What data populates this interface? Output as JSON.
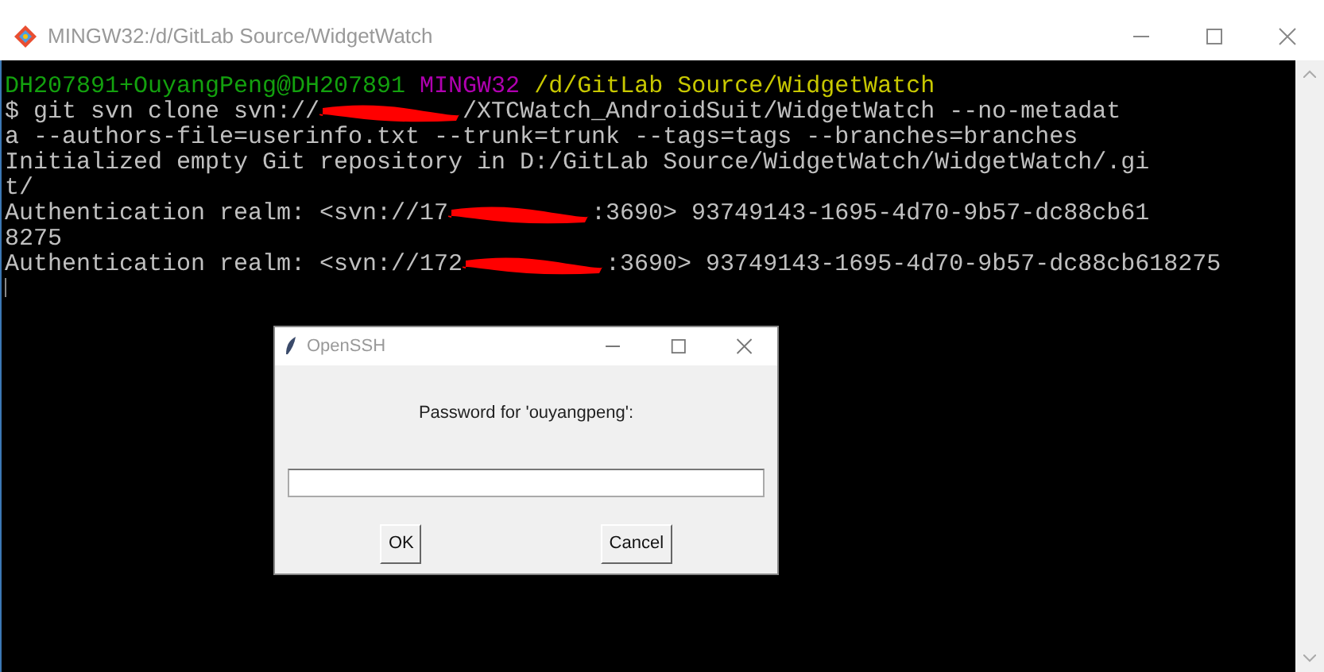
{
  "window": {
    "title": "MINGW32:/d/GitLab Source/WidgetWatch"
  },
  "terminal": {
    "prompt": [
      {
        "kind": "user",
        "text": "DH207891+OuyangPeng@DH207891"
      },
      {
        "kind": "system",
        "text": "MINGW32"
      },
      {
        "kind": "path",
        "text": "/d/GitLab Source/WidgetWatch"
      }
    ],
    "lines": [
      [
        {
          "kind": "text",
          "text": "$ git svn clone svn://"
        },
        {
          "kind": "redaction"
        },
        {
          "kind": "text",
          "text": "/XTCWatch_AndroidSuit/WidgetWatch --no-metadat"
        }
      ],
      [
        {
          "kind": "text",
          "text": "a --authors-file=userinfo.txt --trunk=trunk --tags=tags --branches=branches"
        }
      ],
      [
        {
          "kind": "text",
          "text": "Initialized empty Git repository in D:/GitLab Source/WidgetWatch/WidgetWatch/.gi"
        }
      ],
      [
        {
          "kind": "text",
          "text": "t/"
        }
      ],
      [
        {
          "kind": "text",
          "text": "Authentication realm: <svn://17"
        },
        {
          "kind": "redaction"
        },
        {
          "kind": "text",
          "text": ":3690> 93749143-1695-4d70-9b57-dc88cb61"
        }
      ],
      [
        {
          "kind": "text",
          "text": "8275"
        }
      ],
      [
        {
          "kind": "text",
          "text": "Authentication realm: <svn://172"
        },
        {
          "kind": "redaction"
        },
        {
          "kind": "text",
          "text": ":3690> 93749143-1695-4d70-9b57-dc88cb618275"
        }
      ]
    ]
  },
  "dialog": {
    "title": "OpenSSH",
    "prompt": "Password for 'ouyangpeng':",
    "buttons": [
      "OK",
      "Cancel"
    ]
  }
}
